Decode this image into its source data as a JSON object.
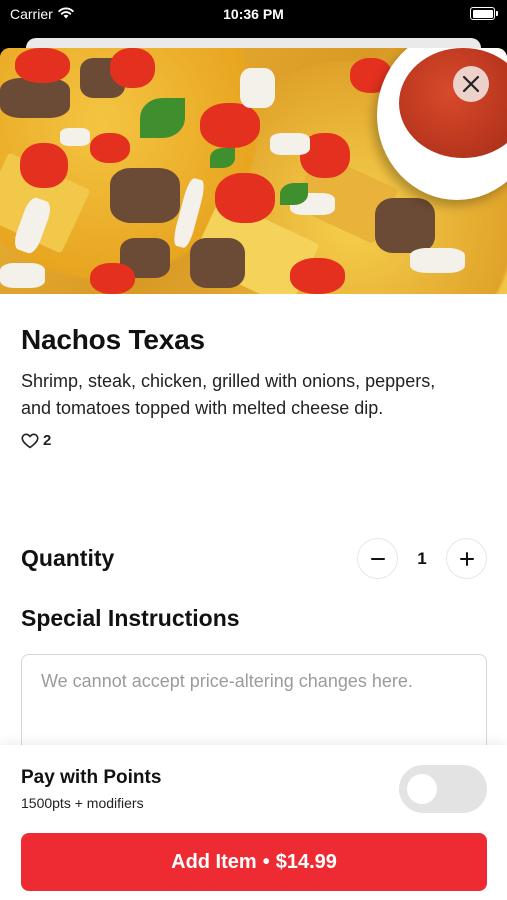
{
  "status_bar": {
    "carrier": "Carrier",
    "time": "10:36 PM",
    "icons": [
      "wifi-icon",
      "battery-icon"
    ]
  },
  "item": {
    "name": "Nachos Texas",
    "description": "Shrimp, steak, chicken, grilled with onions, peppers, and tomatoes topped with melted cheese dip.",
    "likes": "2",
    "image": "nachos-photo"
  },
  "close_icon": "close-icon",
  "quantity": {
    "label": "Quantity",
    "value": "1",
    "decrement_icon": "minus-icon",
    "increment_icon": "plus-icon"
  },
  "special_instructions": {
    "label": "Special Instructions",
    "value": "",
    "placeholder": "We cannot accept price-altering changes here."
  },
  "points": {
    "title": "Pay with Points",
    "subtitle": "1500pts + modifiers",
    "enabled": false
  },
  "add_button": {
    "label": "Add Item",
    "separator": "•",
    "price": "$14.99"
  },
  "colors": {
    "accent": "#ee2a33",
    "toggle_off": "#e3e3e3"
  }
}
